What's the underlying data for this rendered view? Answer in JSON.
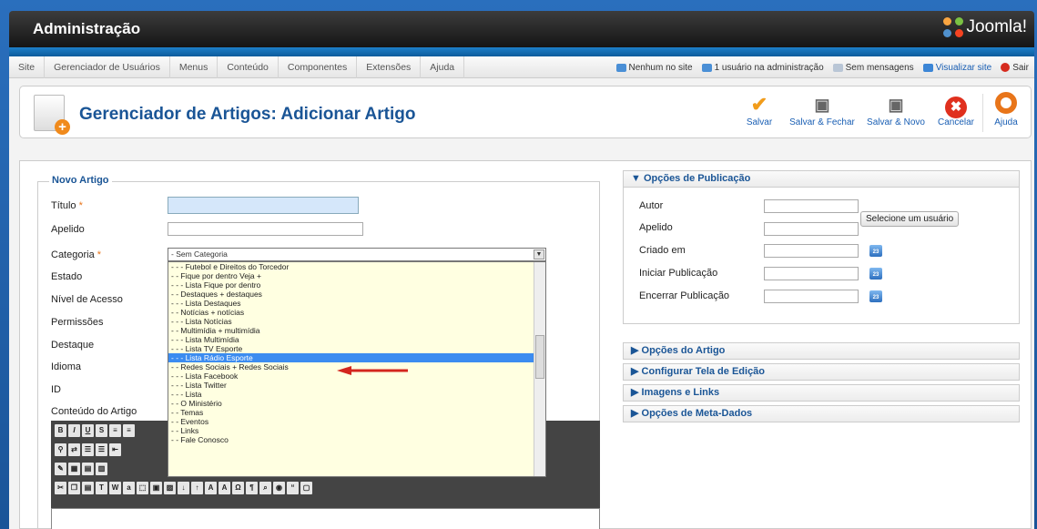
{
  "header": {
    "title": "Administração",
    "logo_text": "Joomla!"
  },
  "menu": [
    "Site",
    "Gerenciador de Usuários",
    "Menus",
    "Conteúdo",
    "Componentes",
    "Extensões",
    "Ajuda"
  ],
  "status": {
    "site": "Nenhum no site",
    "admin": "1 usuário na administração",
    "messages": "Sem mensagens",
    "view_site": "Visualizar site",
    "logout": "Sair"
  },
  "toolbar": {
    "page_title": "Gerenciador de Artigos: Adicionar Artigo",
    "save": "Salvar",
    "save_close": "Salvar & Fechar",
    "save_new": "Salvar & Novo",
    "cancel": "Cancelar",
    "help": "Ajuda"
  },
  "form": {
    "legend": "Novo Artigo",
    "labels": {
      "title": "Título",
      "alias": "Apelido",
      "category": "Categoria",
      "state": "Estado",
      "access": "Nível de Acesso",
      "permissions": "Permissões",
      "featured": "Destaque",
      "language": "Idioma",
      "id": "ID",
      "content": "Conteúdo do Artigo"
    },
    "required_mark": "*",
    "category_selected": "- Sem Categoria",
    "category_options": [
      "- - - Futebol e Direitos do Torcedor",
      "- - Fique por dentro Veja +",
      "- - - Lista Fique por dentro",
      "- - Destaques + destaques",
      "- - - Lista Destaques",
      "- - Notícias + notícias",
      "- - - Lista Notícias",
      "- - Multimídia + multimídia",
      "- - - Lista Multimídia",
      "- - - Lista TV Esporte",
      "- - - Lista Rádio Esporte",
      "- - Redes Sociais + Redes Sociais",
      "- - - Lista Facebook",
      "- - - Lista Twitter",
      "- - - Lista",
      "- - O Ministério",
      "- - Temas",
      "- - Eventos",
      "- - Links",
      "- - Fale Conosco"
    ],
    "highlighted_index": 10
  },
  "right": {
    "publishing": {
      "title": "Opções de Publicação",
      "author": "Autor",
      "select_user": "Selecione um usuário",
      "alias": "Apelido",
      "created": "Criado em",
      "start": "Iniciar Publicação",
      "finish": "Encerrar Publicação"
    },
    "sections": [
      "Opções do Artigo",
      "Configurar Tela de Edição",
      "Imagens e Links",
      "Opções de Meta-Dados"
    ],
    "calendar_label": "23",
    "expanded_icon": "▼",
    "collapsed_icon": "▶"
  },
  "colors": {
    "accent": "#1a5596",
    "highlight": "#3c8cf0",
    "dropdown_bg": "#ffffe1"
  }
}
